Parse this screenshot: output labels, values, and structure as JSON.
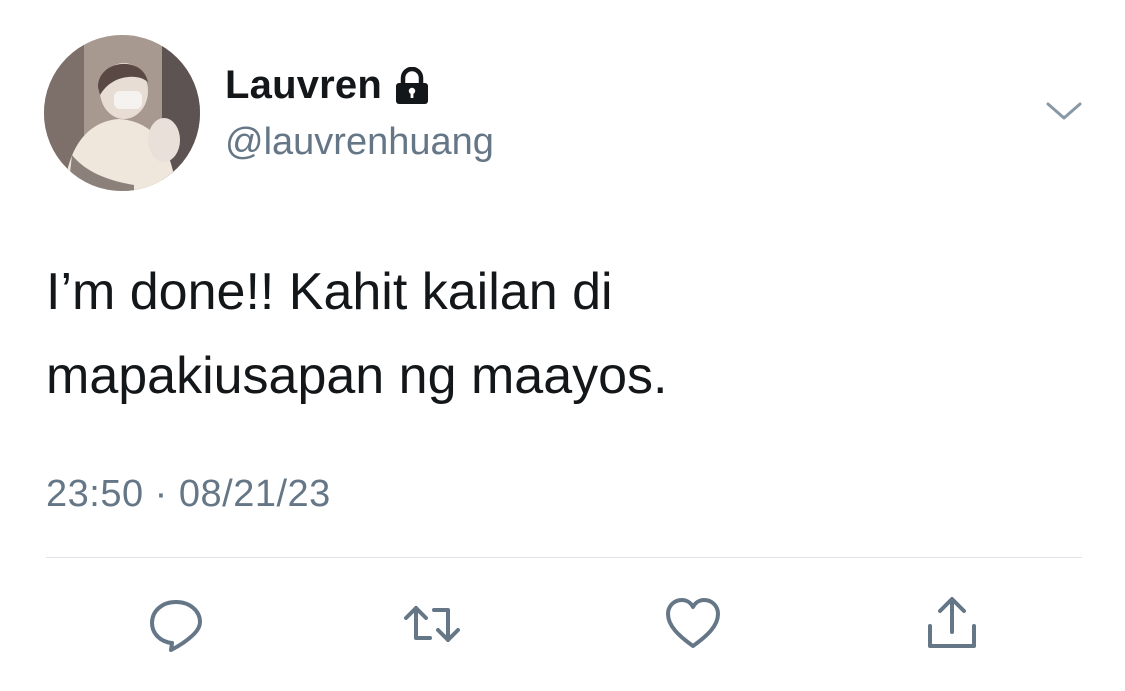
{
  "header": {
    "display_name": "Lauvren",
    "handle": "@lauvrenhuang"
  },
  "icons": {
    "protected": "lock-icon",
    "more": "chevron-down-icon",
    "reply": "reply-icon",
    "retweet": "retweet-icon",
    "like": "heart-icon",
    "share": "share-icon"
  },
  "tweet": {
    "text": "I’m done!! Kahit kailan di\nmapakiusapan ng maayos.",
    "timestamp": "23:50 · 08/21/23"
  },
  "colors": {
    "text_primary": "#14171a",
    "text_secondary": "#657786",
    "icon": "#657786",
    "divider": "#dfe3e7"
  }
}
